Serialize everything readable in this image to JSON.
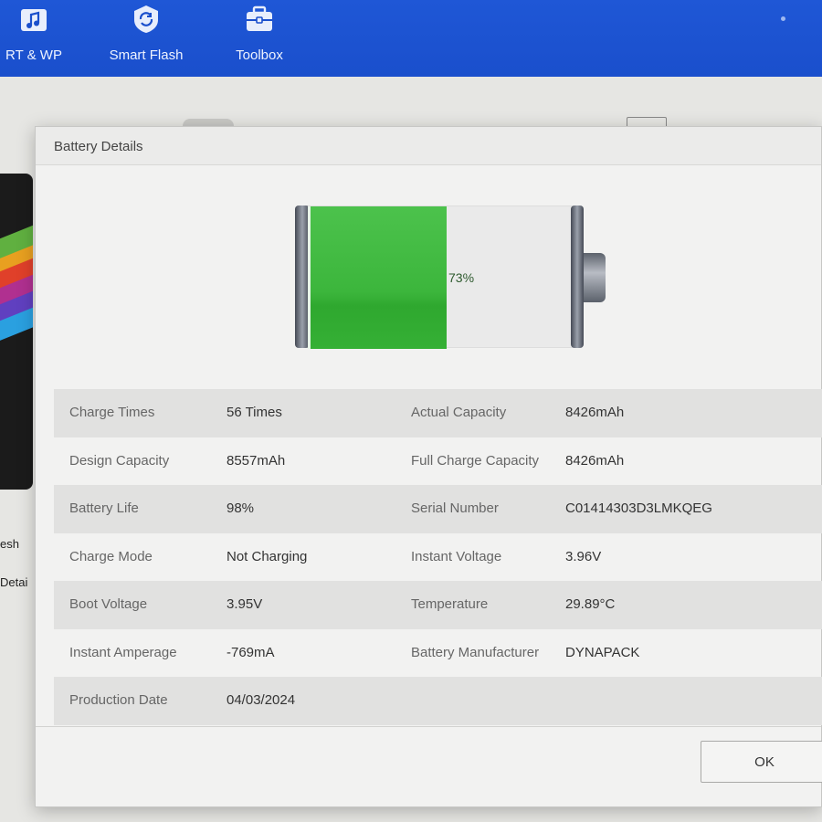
{
  "toolbar": {
    "items": [
      {
        "label": "RT & WP",
        "icon": "music-folder-icon"
      },
      {
        "label": "Smart Flash",
        "icon": "refresh-shield-icon"
      },
      {
        "label": "Toolbox",
        "icon": "toolbox-icon"
      }
    ],
    "color": "#1a4fcc"
  },
  "background": {
    "left_labels": [
      "esh",
      "Detai"
    ]
  },
  "dialog": {
    "title": "Battery Details",
    "battery": {
      "percent_label": "73%",
      "level": 0.73,
      "fill_color": "#3cb63c"
    },
    "rows": [
      {
        "label1": "Charge Times",
        "value1": "56 Times",
        "label2": "Actual Capacity",
        "value2": "8426mAh"
      },
      {
        "label1": "Design Capacity",
        "value1": "8557mAh",
        "label2": "Full Charge Capacity",
        "value2": "8426mAh"
      },
      {
        "label1": "Battery Life",
        "value1": "98%",
        "label2": "Serial Number",
        "value2": "C01414303D3LMKQEG"
      },
      {
        "label1": "Charge Mode",
        "value1": "Not Charging",
        "label2": "Instant Voltage",
        "value2": "3.96V"
      },
      {
        "label1": "Boot Voltage",
        "value1": "3.95V",
        "label2": "Temperature",
        "value2": "29.89°C"
      },
      {
        "label1": "Instant Amperage",
        "value1": "-769mA",
        "label2": "Battery Manufacturer",
        "value2": "DYNAPACK"
      },
      {
        "label1": "Production Date",
        "value1": "04/03/2024",
        "label2": "",
        "value2": ""
      }
    ],
    "ok_label": "OK"
  }
}
